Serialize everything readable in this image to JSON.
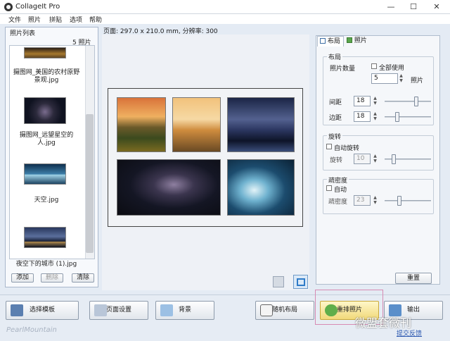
{
  "app": {
    "title": "CollageIt Pro"
  },
  "window_controls": {
    "minimize": "—",
    "maximize": "☐",
    "close": "✕"
  },
  "menu": [
    "文件",
    "照片",
    "拼贴",
    "选项",
    "帮助"
  ],
  "photo_list": {
    "header": "照片列表",
    "count": "5 照片",
    "items": [
      {
        "caption": "摄图网_美国的农村原野景观.jpg"
      },
      {
        "caption": "摄图网_远望星空的人.jpg"
      },
      {
        "caption": "天空.jpg"
      },
      {
        "caption": "夜空下的城市 (1).jpg"
      }
    ],
    "buttons": {
      "add": "添加",
      "remove": "删除",
      "clear": "清除"
    }
  },
  "page_info": "页面: 297.0 x 210.0 mm, 分辨率: 300",
  "tabs": {
    "layout": "布局",
    "photo": "照片"
  },
  "layout_panel": {
    "group_title": "布局",
    "photo_count_label": "照片数量",
    "use_all_label": "全部使用",
    "photo_count_value": "5",
    "photo_unit": "照片",
    "spacing_label": "间距",
    "spacing_value": "18",
    "margin_label": "边距",
    "margin_value": "18"
  },
  "rotation_panel": {
    "group_title": "旋转",
    "auto_label": "自动旋转",
    "rotate_label": "旋转",
    "rotate_value": "10"
  },
  "density_panel": {
    "group_title": "疏密度",
    "auto_label": "自动",
    "density_label": "疏密度",
    "density_value": "23"
  },
  "reset_label": "重置",
  "bottom": {
    "choose_template": "选择模板",
    "page_setup": "页面设置",
    "background": "背景",
    "random_layout": "随机布局",
    "rearrange_photos": "重排照片",
    "output": "输出",
    "feedback": "提交反馈",
    "brand": "PearlMountain"
  },
  "watermark": "微盟套微刊"
}
